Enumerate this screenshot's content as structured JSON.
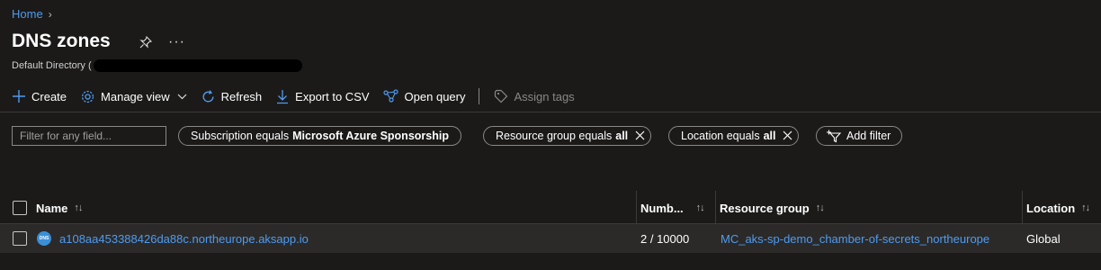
{
  "breadcrumb": {
    "home": "Home",
    "chevron": "›"
  },
  "page": {
    "title": "DNS zones",
    "subtitle_prefix": "Default Directory ("
  },
  "toolbar": {
    "create": "Create",
    "manage_view": "Manage view",
    "refresh": "Refresh",
    "export_csv": "Export to CSV",
    "open_query": "Open query",
    "assign_tags": "Assign tags"
  },
  "filters": {
    "placeholder": "Filter for any field...",
    "subscription": {
      "label": "Subscription equals",
      "value": "Microsoft Azure Sponsorship"
    },
    "resource_group": {
      "label": "Resource group equals",
      "value": "all"
    },
    "location": {
      "label": "Location equals",
      "value": "all"
    },
    "add_filter": "Add filter"
  },
  "table": {
    "columns": [
      "Name",
      "Numb...",
      "Resource group",
      "Location"
    ],
    "rows": [
      {
        "name": "a108aa453388426da88c.northeurope.aksapp.io",
        "icon_text": "DNS",
        "records": "2 / 10000",
        "resource_group": "MC_aks-sp-demo_chamber-of-secrets_northeurope",
        "location": "Global"
      }
    ]
  },
  "colors": {
    "background": "#1b1a19",
    "accent": "#4f9bf0",
    "row": "#2b2a29"
  }
}
